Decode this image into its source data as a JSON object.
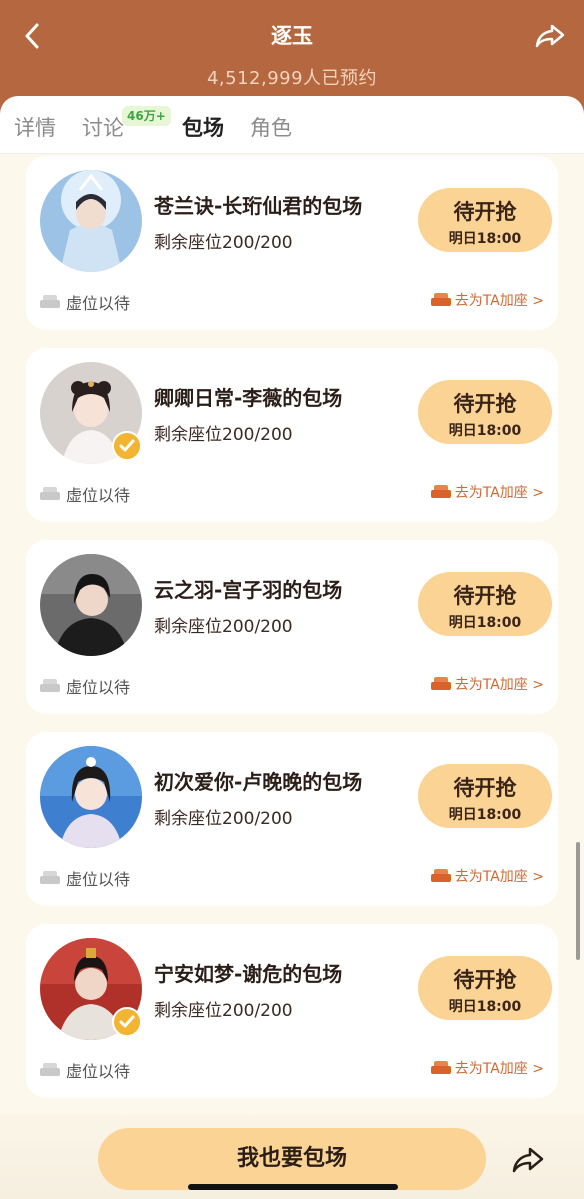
{
  "header": {
    "title": "逐玉",
    "subtitle": "4,512,999人已预约",
    "back_icon": "chevron-left-icon",
    "share_icon": "share-arrow-icon",
    "bg_color": "#b5683f"
  },
  "tabs": [
    {
      "label": "详情",
      "active": false
    },
    {
      "label": "讨论",
      "active": false,
      "badge": "46万+"
    },
    {
      "label": "包场",
      "active": true
    },
    {
      "label": "角色",
      "active": false
    }
  ],
  "cards": [
    {
      "title": "苍兰诀-长珩仙君的包场",
      "seats": "剩余座位200/200",
      "button": "待开抢",
      "time": "明日18:00",
      "wait": "虚位以待",
      "join": "去为TA加座 >",
      "verified": false
    },
    {
      "title": "卿卿日常-李薇的包场",
      "seats": "剩余座位200/200",
      "button": "待开抢",
      "time": "明日18:00",
      "wait": "虚位以待",
      "join": "去为TA加座 >",
      "verified": true
    },
    {
      "title": "云之羽-宫子羽的包场",
      "seats": "剩余座位200/200",
      "button": "待开抢",
      "time": "明日18:00",
      "wait": "虚位以待",
      "join": "去为TA加座 >",
      "verified": false
    },
    {
      "title": "初次爱你-卢晚晚的包场",
      "seats": "剩余座位200/200",
      "button": "待开抢",
      "time": "明日18:00",
      "wait": "虚位以待",
      "join": "去为TA加座 >",
      "verified": false
    },
    {
      "title": "宁安如梦-谢危的包场",
      "seats": "剩余座位200/200",
      "button": "待开抢",
      "time": "明日18:00",
      "wait": "虚位以待",
      "join": "去为TA加座 >",
      "verified": true
    }
  ],
  "bottom": {
    "cta_label": "我也要包场",
    "share_icon": "share-arrow-icon",
    "accent": "#fbd495"
  }
}
